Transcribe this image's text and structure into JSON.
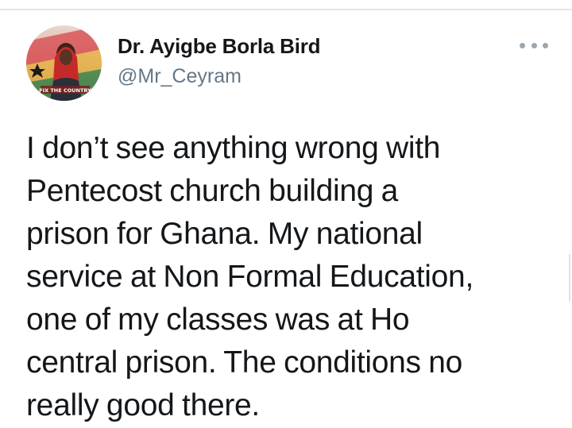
{
  "tweet": {
    "author": {
      "display_name": "Dr. Ayigbe Borla Bird",
      "handle": "@Mr_Ceyram",
      "avatar_banner_text": "FIX THE COUNTRY"
    },
    "more_icon": "more-dots-icon",
    "text_lines": [
      "I don’t see anything wrong with",
      "Pentecost church building a",
      "prison for Ghana. My national",
      "service at Non Formal Education,",
      "one of my classes was at Ho",
      "central prison. The conditions no",
      "really good there."
    ]
  },
  "colors": {
    "text_primary": "#14171a",
    "text_secondary": "#657786",
    "divider": "#e3e6e8"
  }
}
